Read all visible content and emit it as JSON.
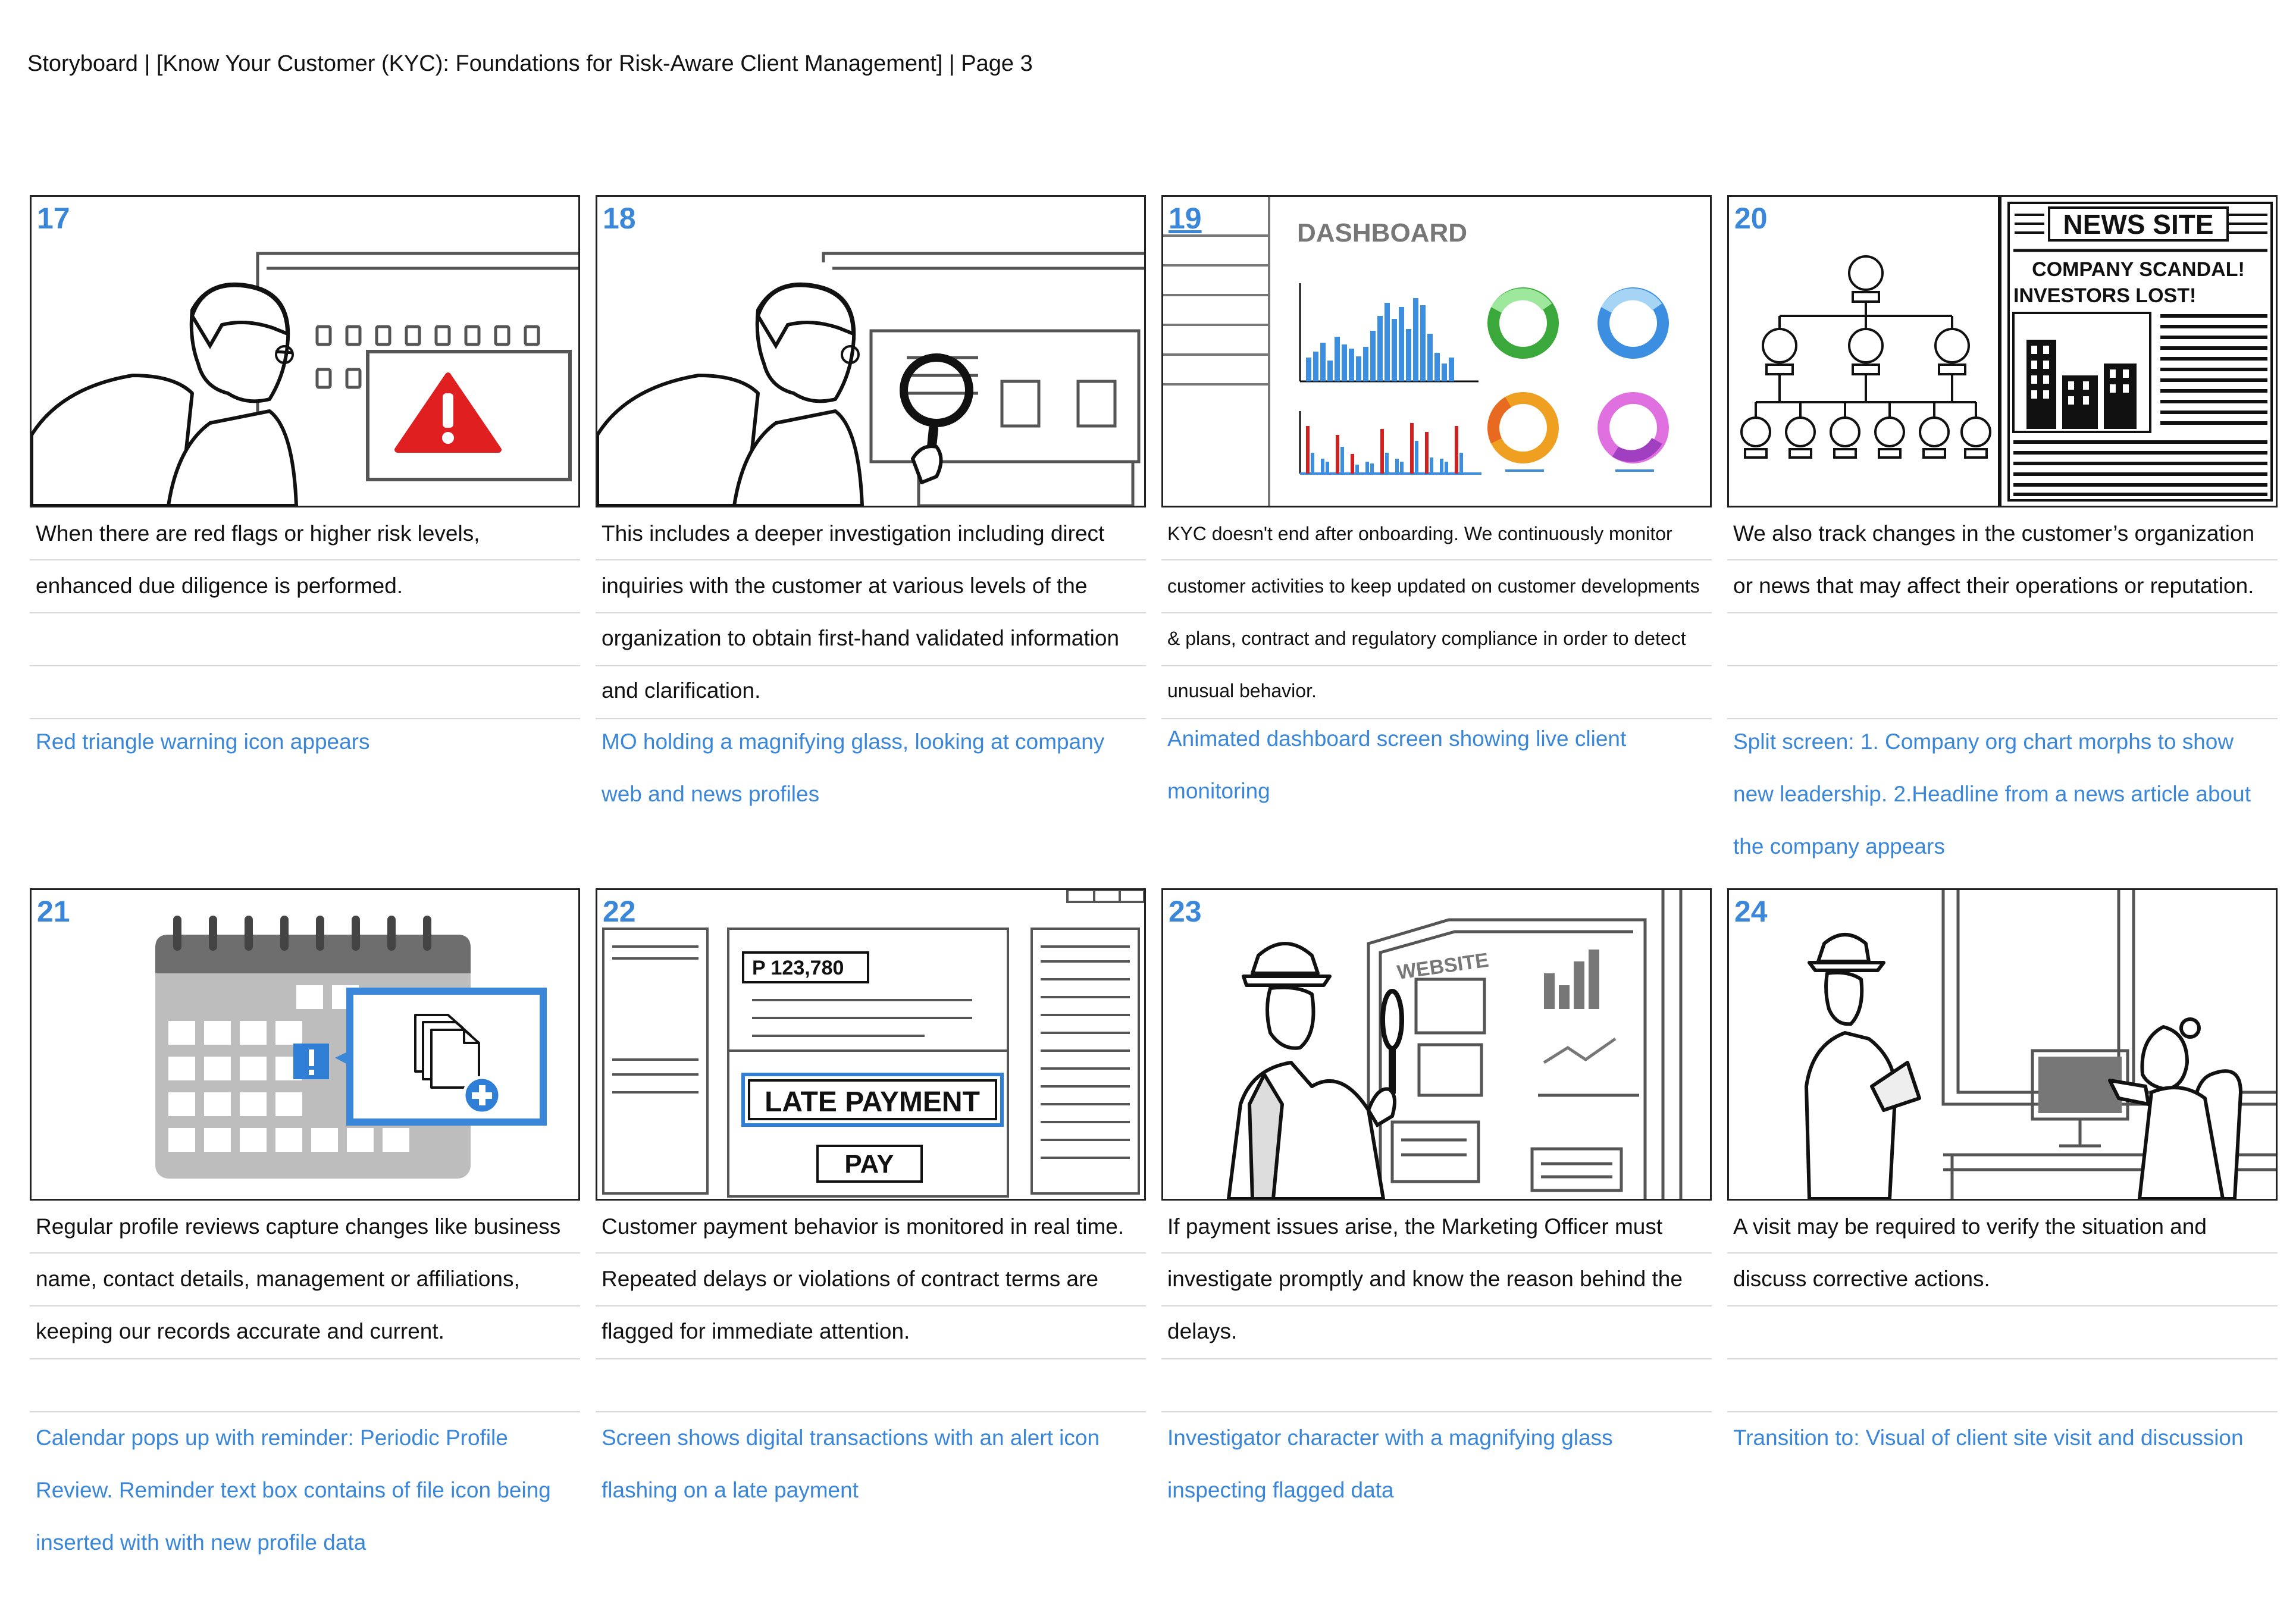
{
  "page_title": "Storyboard | [Know Your Customer (KYC): Foundations for Risk-Aware Client Management] | Page 3",
  "panels": [
    {
      "number": "17",
      "narration": "When there are red flags or higher risk levels, enhanced due diligence is performed.",
      "note": "Red triangle warning icon appears"
    },
    {
      "number": "18",
      "narration": "This includes a deeper investigation including direct inquiries with the customer at various levels of the organization to obtain first-hand validated information and clarification.",
      "note": "MO holding a magnifying glass, looking at company web and news profiles"
    },
    {
      "number": "19",
      "narration": "KYC doesn't end after onboarding. We continuously monitor customer activities to keep updated on customer developments & plans, contract and regulatory compliance in order to detect unusual behavior.",
      "note": "Animated dashboard screen showing live client monitoring",
      "art_text": {
        "dashboard_title": "DASHBOARD"
      }
    },
    {
      "number": "20",
      "narration": "We also track changes in the customer’s organization or news that may affect their operations or reputation.",
      "note": "Split screen: 1. Company org chart morphs to show new leadership. 2.Headline from a news article about the company appears",
      "art_text": {
        "news_site": "NEWS SITE",
        "headline_1": "COMPANY SCANDAL!",
        "headline_2": "INVESTORS LOST!"
      }
    },
    {
      "number": "21",
      "narration": "Regular profile reviews capture changes like business name, contact details, management or affiliations, keeping our records accurate and current.",
      "note": "Calendar pops up with reminder: Periodic Profile Review. Reminder text box contains of file icon being inserted with with new profile data"
    },
    {
      "number": "22",
      "narration": "Customer payment behavior is monitored in real time. Repeated delays or violations of contract terms are flagged for immediate attention.",
      "note": "Screen shows digital transactions with an alert icon flashing on a late payment",
      "art_text": {
        "amount": "P 123,780",
        "late_payment": "LATE PAYMENT",
        "pay": "PAY"
      }
    },
    {
      "number": "23",
      "narration": "If payment issues arise, the Marketing Officer must investigate promptly and know the reason behind the delays.",
      "note": "Investigator character with a magnifying glass inspecting flagged data",
      "art_text": {
        "website": "WEBSITE"
      }
    },
    {
      "number": "24",
      "narration": "A visit may be required to verify the situation and discuss corrective actions.",
      "note": "Transition to: Visual of client site visit and discussion"
    }
  ],
  "colors": {
    "accent_blue": "#3a86d9",
    "alert_red": "#e02020",
    "rule_gray": "#d7d7d7"
  }
}
